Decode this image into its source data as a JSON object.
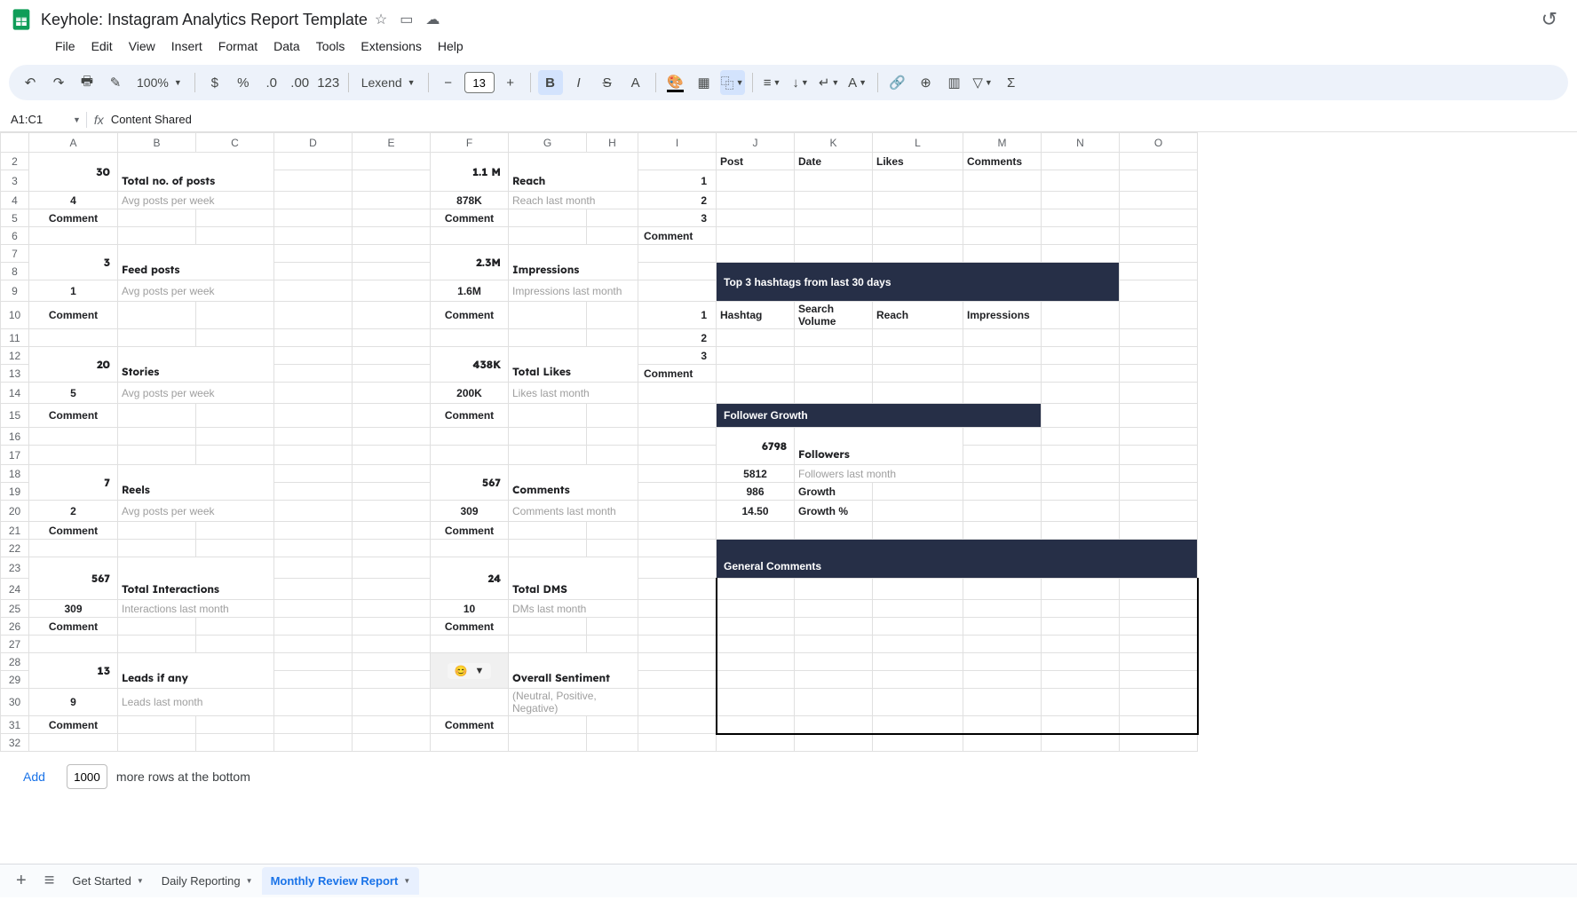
{
  "doc": {
    "title": "Keyhole: Instagram Analytics Report Template"
  },
  "menu": [
    "File",
    "Edit",
    "View",
    "Insert",
    "Format",
    "Data",
    "Tools",
    "Extensions",
    "Help"
  ],
  "toolbar": {
    "zoom": "100%",
    "font": "Lexend",
    "font_size": "13"
  },
  "name_box": "A1:C1",
  "formula": "Content Shared",
  "cols": [
    "A",
    "B",
    "C",
    "D",
    "E",
    "F",
    "G",
    "H",
    "I",
    "J",
    "K",
    "L",
    "M",
    "N",
    "O"
  ],
  "row_count_start": 2,
  "row_count_end": 32,
  "metrics": {
    "posts": {
      "big": "30",
      "label": "Total no. of posts",
      "sub": "4",
      "sublabel": "Avg posts per week",
      "comment": "Comment"
    },
    "feed": {
      "big": "3",
      "label": "Feed posts",
      "sub": "1",
      "sublabel": "Avg posts per week",
      "comment": "Comment"
    },
    "stories": {
      "big": "20",
      "label": "Stories",
      "sub": "5",
      "sublabel": "Avg posts per week",
      "comment": "Comment"
    },
    "reels": {
      "big": "7",
      "label": "Reels",
      "sub": "2",
      "sublabel": "Avg posts per week",
      "comment": "Comment"
    },
    "interactions": {
      "big": "567",
      "label": "Total Interactions",
      "sub": "309",
      "sublabel": "Interactions last month",
      "comment": "Comment"
    },
    "leads": {
      "big": "13",
      "label": "Leads if any",
      "sub": "9",
      "sublabel": "Leads last month",
      "comment": "Comment"
    },
    "reach": {
      "big": "1.1 M",
      "label": "Reach",
      "sub": "878K",
      "sublabel": "Reach last month",
      "comment": "Comment"
    },
    "impressions": {
      "big": "2.3M",
      "label": "Impressions",
      "sub": "1.6M",
      "sublabel": "Impressions last month",
      "comment": "Comment"
    },
    "likes": {
      "big": "438K",
      "label": "Total Likes",
      "sub": "200K",
      "sublabel": "Likes last month",
      "comment": "Comment"
    },
    "comments_m": {
      "big": "567",
      "label": "Comments",
      "sub": "309",
      "sublabel": "Comments last month",
      "comment": "Comment"
    },
    "dms": {
      "big": "24",
      "label": "Total DMS",
      "sub": "10",
      "sublabel": "DMs last month",
      "comment": "Comment"
    },
    "sentiment": {
      "emoji": "😊",
      "label": "Overall Sentiment",
      "sublabel": "(Neutral, Positive, Negative)",
      "comment": "Comment"
    }
  },
  "posts_table": {
    "headers": {
      "post": "Post",
      "date": "Date",
      "likes": "Likes",
      "comments": "Comments"
    },
    "rows": [
      "1",
      "2",
      "3"
    ],
    "comment": "Comment"
  },
  "hashtags": {
    "title": "Top 3 hashtags from last 30 days",
    "headers": {
      "hashtag": "Hashtag",
      "volume": "Search Volume",
      "reach": "Reach",
      "impressions": "Impressions"
    },
    "rows": [
      "1",
      "2",
      "3"
    ],
    "comment": "Comment"
  },
  "follower_growth": {
    "title": "Follower Growth",
    "big": "6798",
    "label": "Followers",
    "sub": "5812",
    "sublabel": "Followers last month",
    "growth": "986",
    "growth_label": "Growth",
    "growth_pct": "14.50",
    "growth_pct_label": "Growth %"
  },
  "general_comments": {
    "title": "General Comments"
  },
  "bottom": {
    "add": "Add",
    "count": "1000",
    "suffix": "more rows at the bottom"
  },
  "tabs": [
    "Get Started",
    "Daily Reporting",
    "Monthly Review Report"
  ],
  "active_tab": 2
}
